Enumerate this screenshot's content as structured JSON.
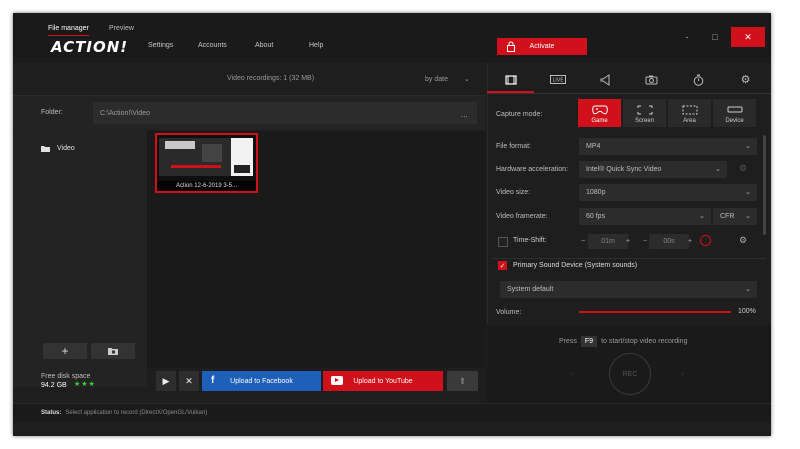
{
  "app": {
    "logo": "ACTION!",
    "menu": [
      "Settings",
      "Accounts",
      "About",
      "Help"
    ],
    "activate_label": "Activate",
    "minimize": "-",
    "maximize": "□",
    "close": "✕"
  },
  "left_panel": {
    "tabs": [
      "File manager",
      "Preview"
    ],
    "recordings_count": "Video recordings: 1 (32 MB)",
    "sort_label": "by date",
    "folder_label": "Folder:",
    "folder_path": "C:\\Action!\\Video",
    "folder_more": "...",
    "sidebar_item": "Video",
    "disk_label": "Free disk space",
    "disk_value": "94.2 GB",
    "disk_stars": "★★★",
    "thumbnail_caption": "Action 12-6-2019 3-5...",
    "upload_facebook": "Upload to Facebook",
    "upload_youtube": "Upload to YouTube"
  },
  "status": {
    "label": "Status:",
    "text": "Select application to record (DirectX/OpenGL/Vulkan)"
  },
  "right_panel": {
    "capture_mode_label": "Capture mode:",
    "modes": [
      "Game",
      "Screen",
      "Area",
      "Device"
    ],
    "file_format_label": "File format:",
    "file_format": "MP4",
    "hw_accel_label": "Hardware acceleration:",
    "hw_accel": "Intel® Quick Sync Video",
    "video_size_label": "Video size:",
    "video_size": "1080p",
    "framerate_label": "Video framerate:",
    "framerate": "60 fps",
    "framerate_mode": "CFR",
    "timeshift_label": "Time-Shift:",
    "timeshift_minutes": "01m",
    "timeshift_seconds": "00s",
    "sound_device_label": "Primary Sound Device (System sounds)",
    "sound_select": "System default",
    "volume_label": "Volume:",
    "volume_value": "100%",
    "volume": 100,
    "press_text": "Press",
    "hotkey": "F9",
    "press_suffix": "to start/stop video recording",
    "rec_label": "REC"
  },
  "colors": {
    "accent": "#d0101a",
    "facebook": "#1d5fb9",
    "disk_ok": "#3bd13b"
  }
}
